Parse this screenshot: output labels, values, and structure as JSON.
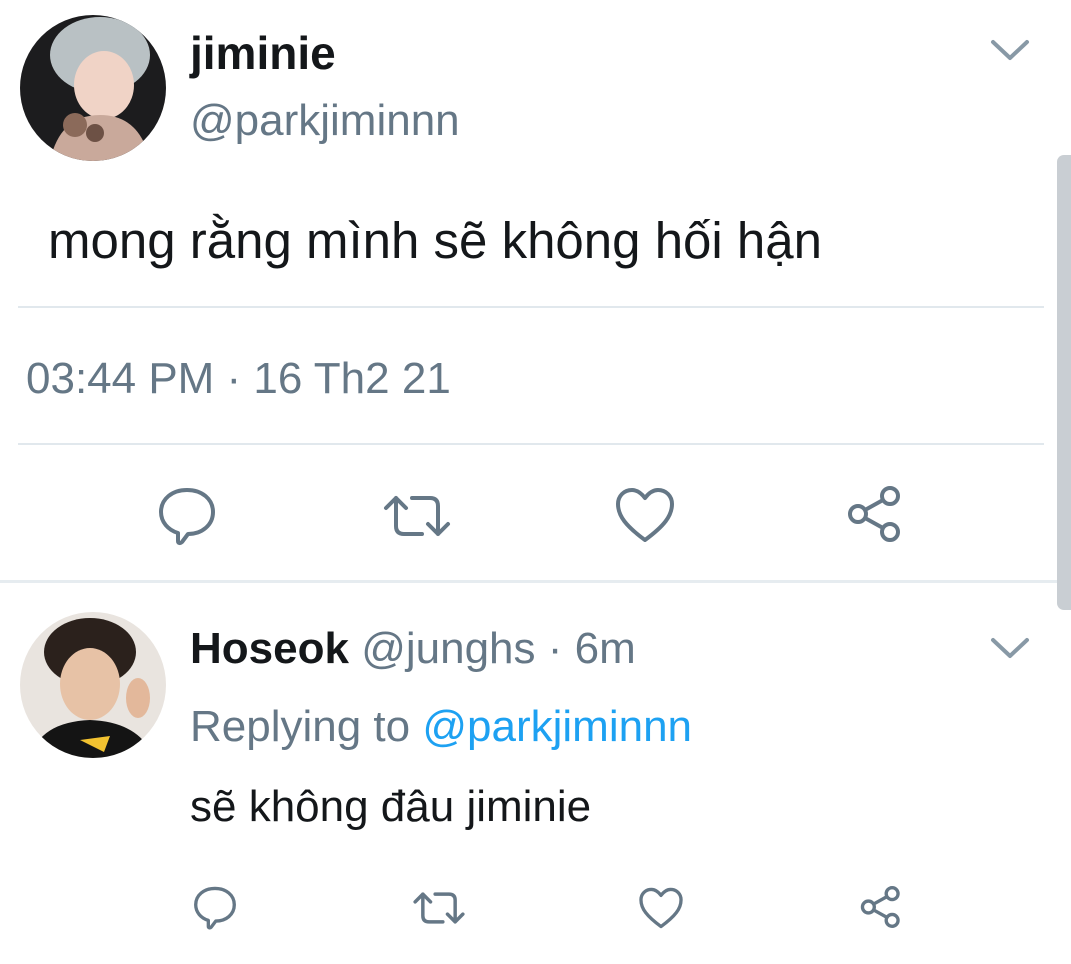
{
  "main_tweet": {
    "display_name": "jiminie",
    "handle": "@parkjiminnn",
    "text": "mong rằng mình sẽ không hối hận",
    "timestamp": "03:44 PM · 16 Th2 21",
    "actions": [
      "reply-icon",
      "retweet-icon",
      "like-icon",
      "share-icon"
    ]
  },
  "reply_tweet": {
    "display_name": "Hoseok",
    "handle": "@junghs",
    "separator": " · ",
    "age": "6m",
    "replying_to_label": "Replying to",
    "replying_to_handle": "@parkjiminnn",
    "text": "sẽ không đâu jiminie",
    "actions": [
      "reply-icon",
      "retweet-icon",
      "like-icon",
      "share-icon"
    ]
  },
  "colors": {
    "text": "#14171a",
    "muted": "#657786",
    "link": "#1da1f2",
    "divider": "#e1e8ed"
  }
}
